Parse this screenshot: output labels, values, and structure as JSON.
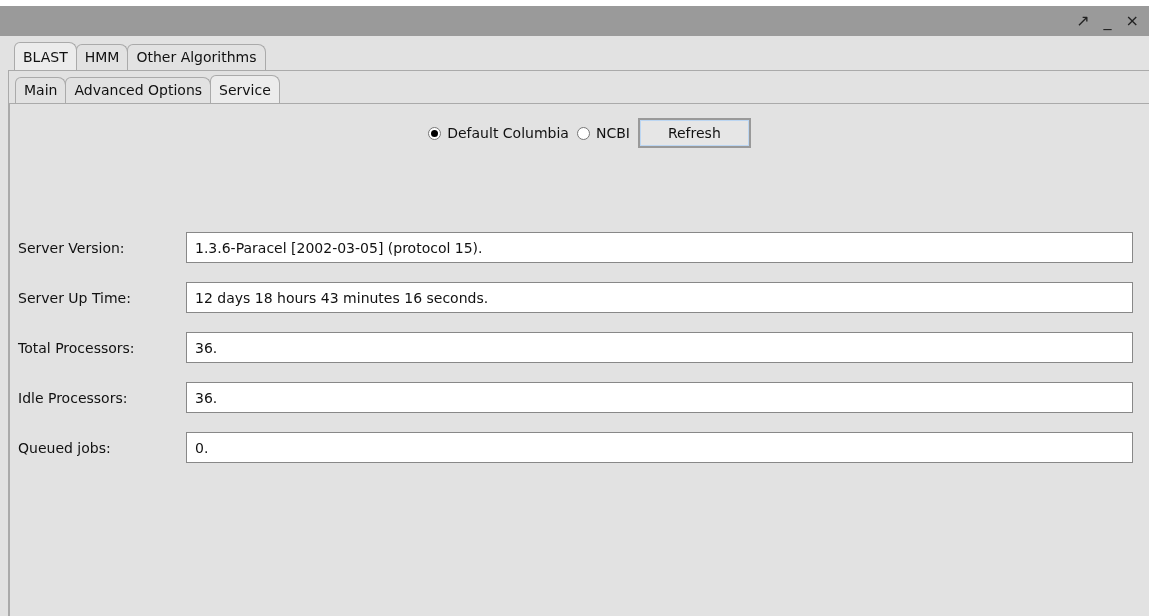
{
  "window": {
    "controls": [
      "↗",
      "_",
      "×"
    ]
  },
  "tabs": [
    {
      "label": "BLAST",
      "selected": true
    },
    {
      "label": "HMM",
      "selected": false
    },
    {
      "label": "Other Algorithms",
      "selected": false
    }
  ],
  "subtabs": [
    {
      "label": "Main",
      "selected": false
    },
    {
      "label": "Advanced Options",
      "selected": false
    },
    {
      "label": "Service",
      "selected": true
    }
  ],
  "service": {
    "options": [
      {
        "label": "Default Columbia",
        "selected": true
      },
      {
        "label": "NCBI",
        "selected": false
      }
    ],
    "refresh_button": "Refresh"
  },
  "fields": [
    {
      "label": "Server Version:",
      "value": "1.3.6-Paracel [2002-03-05] (protocol 15)."
    },
    {
      "label": "Server Up Time:",
      "value": "12 days 18 hours 43 minutes 16 seconds."
    },
    {
      "label": "Total Processors:",
      "value": "36."
    },
    {
      "label": "Idle Processors:",
      "value": "36."
    },
    {
      "label": "Queued jobs:",
      "value": "0."
    }
  ]
}
